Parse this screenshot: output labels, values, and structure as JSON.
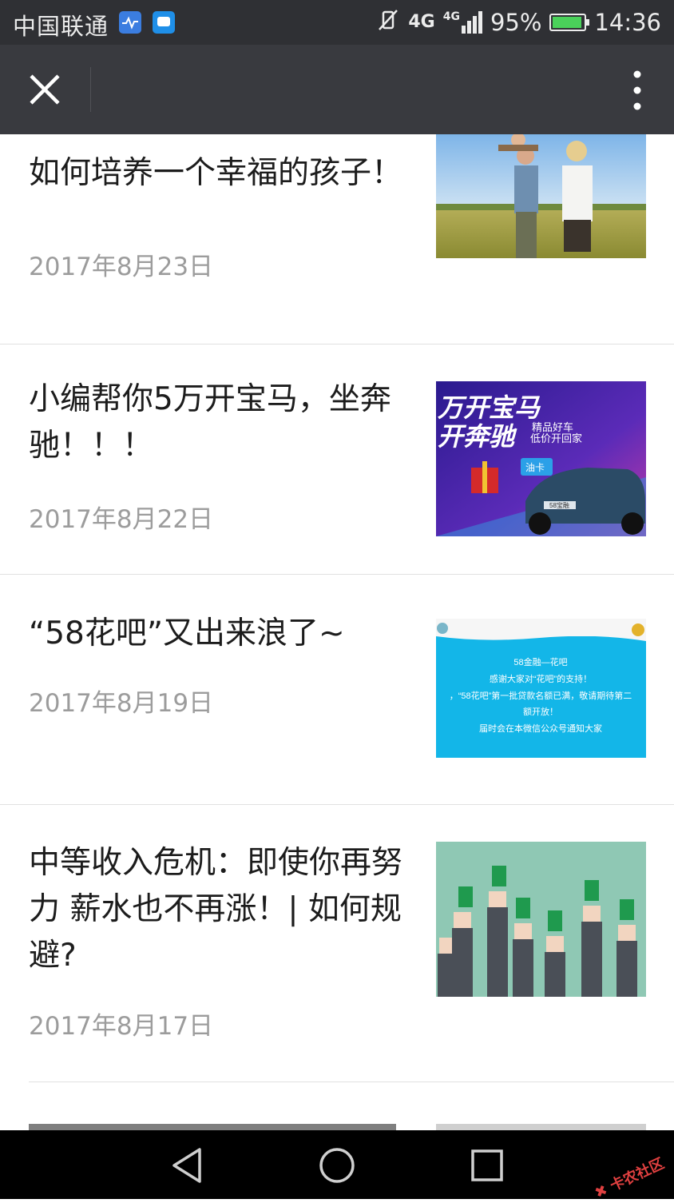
{
  "status_bar": {
    "carrier": "中国联通",
    "network": "4G",
    "network2": "4G",
    "battery": "95%",
    "battery_level": 0.95,
    "time": "14:36",
    "icons": [
      "health-app-icon",
      "message-app-icon",
      "vibrate-off-icon",
      "signal-icon",
      "battery-icon"
    ]
  },
  "nav": {
    "close_icon": "close-icon",
    "more_icon": "more-vertical-icon"
  },
  "articles": [
    {
      "title": "如何培养一个幸福的孩子！",
      "date": "2017年8月23日"
    },
    {
      "title": "小编帮你5万开宝马，坐奔驰！！！",
      "date": "2017年8月22日",
      "thumb_text": {
        "line1": "万开宝马",
        "line2": "开奔驰",
        "tag1": "精品好车",
        "tag2": "低价开回家",
        "card": "油卡",
        "plate": "58宝融"
      }
    },
    {
      "title": "“58花吧”又出来浪了~",
      "date": "2017年8月19日",
      "thumb_text": {
        "l1": "58金融—花吧",
        "l2": "感谢大家对“花吧”的支持！",
        "l3": "，“58花吧”第一批贷款名额已满，敬请期待第二",
        "l4": "额开放！",
        "l5": "届时会在本微信公众号通知大家"
      }
    },
    {
      "title": "中等收入危机：即使你再努力 薪水也不再涨！| 如何规避?",
      "date": "2017年8月17日"
    }
  ],
  "watermark": "卡农社区",
  "colors": {
    "status_bg": "#2f3034",
    "nav_bg": "#393a3f",
    "date": "#9c9c9c",
    "title": "#1c1c1c",
    "battery": "#4ad15a"
  }
}
